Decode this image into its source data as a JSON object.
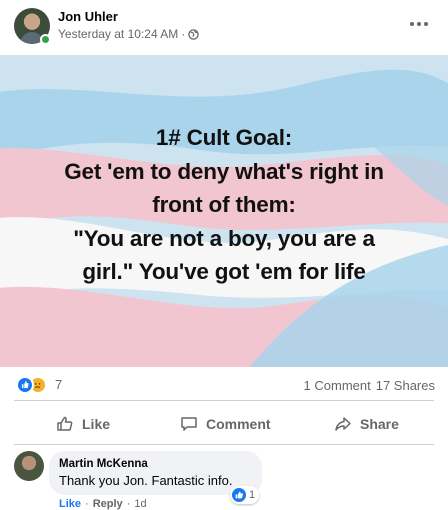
{
  "post": {
    "author": "Jon Uhler",
    "timestamp": "Yesterday at 10:24 AM",
    "separator": "·",
    "privacy_icon": "globe-icon"
  },
  "image": {
    "lines": [
      "1# Cult Goal:",
      "Get 'em to deny what's right in",
      "front of them:",
      "\"You are not a boy, you are a",
      "girl.\" You've got 'em for life"
    ],
    "colors": {
      "blue": "#9fd0ea",
      "pink": "#f2c6d1",
      "white": "#f7f7f8",
      "bg": "#cde3ef"
    }
  },
  "stats": {
    "reaction_count": "7",
    "reactions": [
      "like-icon",
      "sad-icon"
    ],
    "comments": "1 Comment",
    "shares": "17 Shares"
  },
  "actions": {
    "like": "Like",
    "comment": "Comment",
    "share": "Share"
  },
  "comment": {
    "author": "Martin McKenna",
    "text": "Thank you Jon. Fantastic info.",
    "reaction_count": "1",
    "like_label": "Like",
    "reply_label": "Reply",
    "age": "1d",
    "separator": "·"
  },
  "colors": {
    "accent": "#1877f2",
    "secondary_text": "#65676b",
    "online": "#31a24c"
  }
}
